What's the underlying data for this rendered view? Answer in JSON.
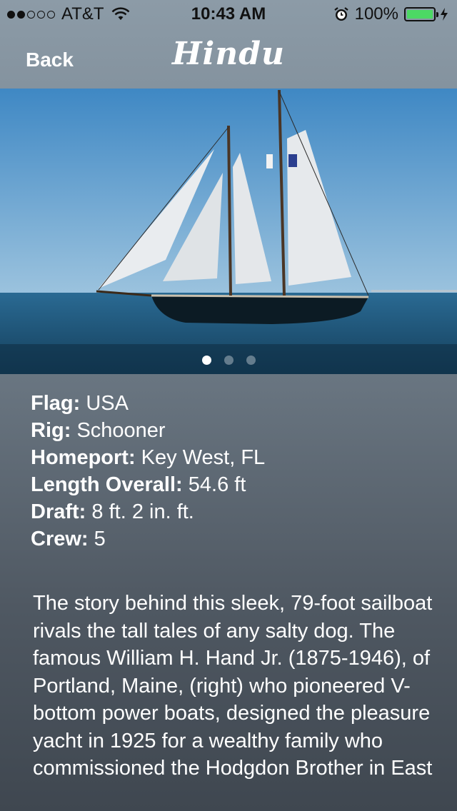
{
  "status": {
    "carrier": "AT&T",
    "time": "10:43 AM",
    "battery": "100%",
    "signal_bars": 2,
    "signal_total": 5
  },
  "nav": {
    "back_label": "Back",
    "title": "Hindu"
  },
  "carousel": {
    "pages": 3,
    "active_page": 1
  },
  "specs": [
    {
      "label": "Flag:",
      "value": "USA"
    },
    {
      "label": "Rig:",
      "value": "Schooner"
    },
    {
      "label": "Homeport:",
      "value": "Key West, FL"
    },
    {
      "label": "Length Overall:",
      "value": "54.6 ft"
    },
    {
      "label": "Draft:",
      "value": "8 ft. 2 in. ft."
    },
    {
      "label": "Crew:",
      "value": "5"
    }
  ],
  "description": "The story behind this sleek, 79-foot sailboat rivals the tall tales of any salty dog. The famous William H. Hand Jr. (1875-1946), of Portland, Maine, (right) who pioneered V-bottom power boats, designed the pleasure yacht in 1925 for a wealthy family who commissioned the Hodgdon Brother in East",
  "colors": {
    "battery_fill": "#4cd964",
    "sky": "#4f93c8",
    "sea": "#1f5c82"
  },
  "icons": [
    "wifi-icon",
    "alarm-icon",
    "battery-icon",
    "charge-icon"
  ]
}
